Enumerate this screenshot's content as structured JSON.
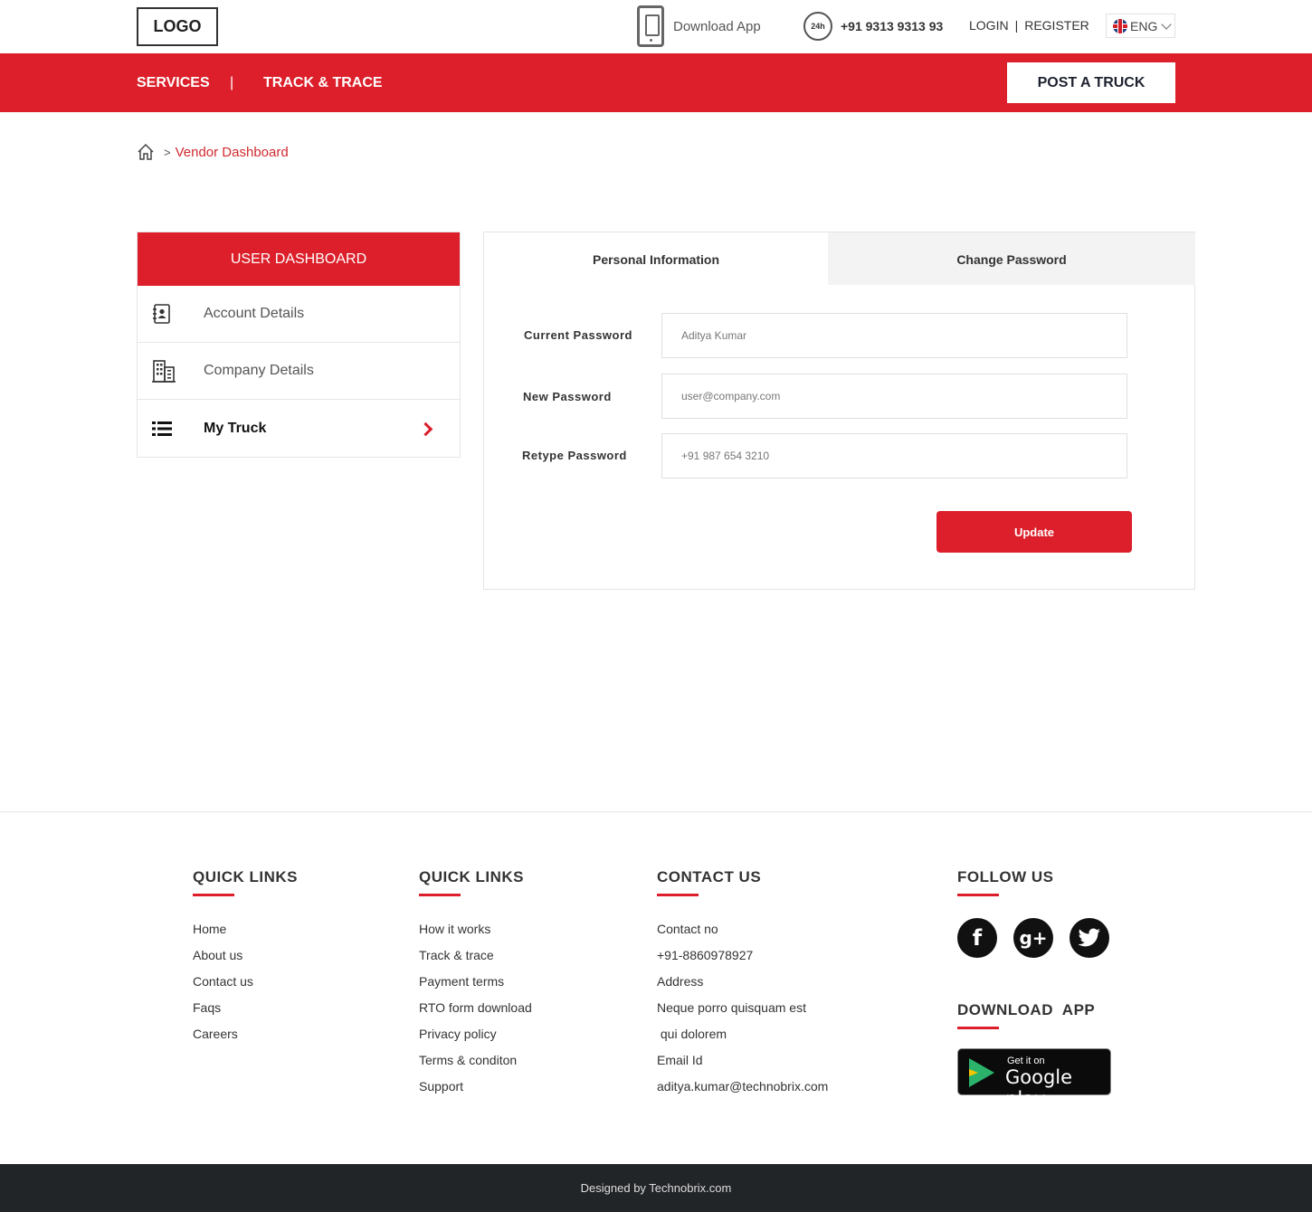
{
  "header": {
    "logo": "LOGO",
    "download_app": "Download App",
    "support_badge": "24h",
    "phone": "+91 9313 9313 93",
    "login": "LOGIN",
    "separator": "|",
    "register": "REGISTER",
    "language": "ENG"
  },
  "nav": {
    "services": "SERVICES",
    "separator": "|",
    "track": "TRACK & TRACE",
    "post_truck": "POST A TRUCK"
  },
  "breadcrumb": {
    "separator": ">",
    "current": "Vendor Dashboard"
  },
  "sidebar": {
    "title": "USER DASHBOARD",
    "items": [
      {
        "label": "Account Details",
        "icon": "contact-book-icon"
      },
      {
        "label": "Company Details",
        "icon": "building-icon"
      },
      {
        "label": "My Truck",
        "icon": "list-icon",
        "active": true
      }
    ]
  },
  "tabs": {
    "personal": "Personal Information",
    "password": "Change Password"
  },
  "form": {
    "current_label": "Current Password",
    "current_placeholder": "Aditya Kumar",
    "new_label": "New Password",
    "new_placeholder": "user@company.com",
    "retype_label": "Retype Password",
    "retype_placeholder": "+91 987 654 3210",
    "update": "Update"
  },
  "footer": {
    "col1": {
      "title": "QUICK LINKS",
      "links": [
        "Home",
        "About us",
        "Contact us",
        "Faqs",
        "Careers"
      ]
    },
    "col2": {
      "title": "QUICK LINKS",
      "links": [
        "How it works",
        "Track & trace",
        "Payment terms",
        "RTO form download",
        "Privacy policy",
        "Terms & conditon",
        "Support"
      ]
    },
    "col3": {
      "title": "CONTACT US",
      "lines": [
        "Contact no",
        "+91-8860978927",
        "Address",
        "Neque porro quisquam est",
        " qui dolorem",
        "Email Id",
        "aditya.kumar@technobrix.com"
      ]
    },
    "follow": {
      "title": "FOLLOW US",
      "facebook": "f",
      "gplus": "g+",
      "twitter": "t"
    },
    "app": {
      "title": "DOWNLOAD  APP",
      "get_it_on": "Get it on",
      "store": "Google play"
    },
    "copyright": "Designed by Technobrix.com"
  },
  "colors": {
    "accent": "#dc1f2a",
    "footer_bar": "#222528"
  }
}
